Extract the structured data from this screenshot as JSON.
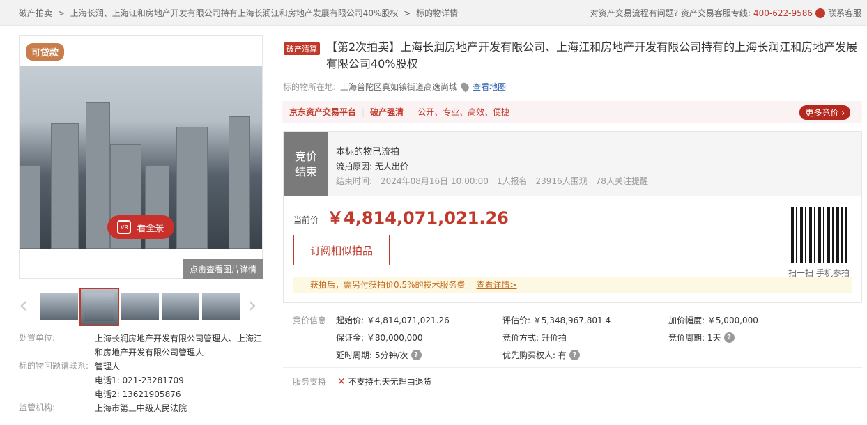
{
  "breadcrumb": [
    "破产拍卖",
    ">",
    "上海长润、上海江和房地产开发有限公司持有上海长润江和房地产发展有限公司40%股权",
    ">",
    "标的物详情"
  ],
  "help": {
    "question": "对资产交易流程有问题? 资产交易客服专线:",
    "phone": "400-622-9586",
    "service": "联系客服"
  },
  "gallery": {
    "badge": "可贷款",
    "panorama": "看全景",
    "vr_label": "VR",
    "detail_button": "点击查看图片详情",
    "prev": "‹",
    "next": "›"
  },
  "left_info": {
    "disposer_label": "处置单位:",
    "disposer": "上海长润房地产开发有限公司管理人、上海江和房地产开发有限公司管理人",
    "contact_label": "标的物问题请联系:",
    "contact": "管理人",
    "phone1": "电话1:  021-23281709",
    "phone2": "电话2:  13621905876",
    "supervisor_label": "监管机构:",
    "supervisor": "上海市第三中级人民法院"
  },
  "item": {
    "tag": "破产清算",
    "title": "【第2次拍卖】上海长润房地产开发有限公司、上海江和房地产开发有限公司持有的上海长润江和房地产发展有限公司40%股权",
    "location_label": "标的物所在地:",
    "location": "上海普陀区真如镇街道高逸尚城",
    "map_link": "查看地图"
  },
  "banner": {
    "platform": "京东资产交易平台",
    "sep": "|",
    "category": "破产强清",
    "slogan": "公开、专业、高效、便捷",
    "more": "更多竞价 ›"
  },
  "status": {
    "badge": "竞价结束",
    "line1": "本标的物已流拍",
    "reason": "流拍原因:  无人出价",
    "end_label": "结束时间:",
    "end_time": "2024年08月16日 10:00:00",
    "signups": "1人报名",
    "views": "23916人围观",
    "follows": "78人关注提醒"
  },
  "price": {
    "label": "当前价",
    "value": "￥4,814,071,021.26",
    "subscribe": "订阅相似拍品",
    "qr_caption": "扫一扫 手机参拍",
    "fee_note": "获拍后，需另付获拍价0.5%的技术服务费",
    "fee_link": "查看详情>"
  },
  "params": {
    "label": "竞价信息",
    "start": "起始价: ￥4,814,071,021.26",
    "appraisal": "评估价: ￥5,348,967,801.4",
    "increment": "加价幅度: ￥5,000,000",
    "deposit": "保证金: ￥80,000,000",
    "mode": "竞价方式: 升价拍",
    "period": "竞价周期: 1天",
    "delay": "延时周期: 5分钟/次",
    "priority": "优先购买权人: 有",
    "help_icon": "?"
  },
  "service": {
    "label": "服务支持",
    "item": "不支持七天无理由退货",
    "x": "✕"
  }
}
